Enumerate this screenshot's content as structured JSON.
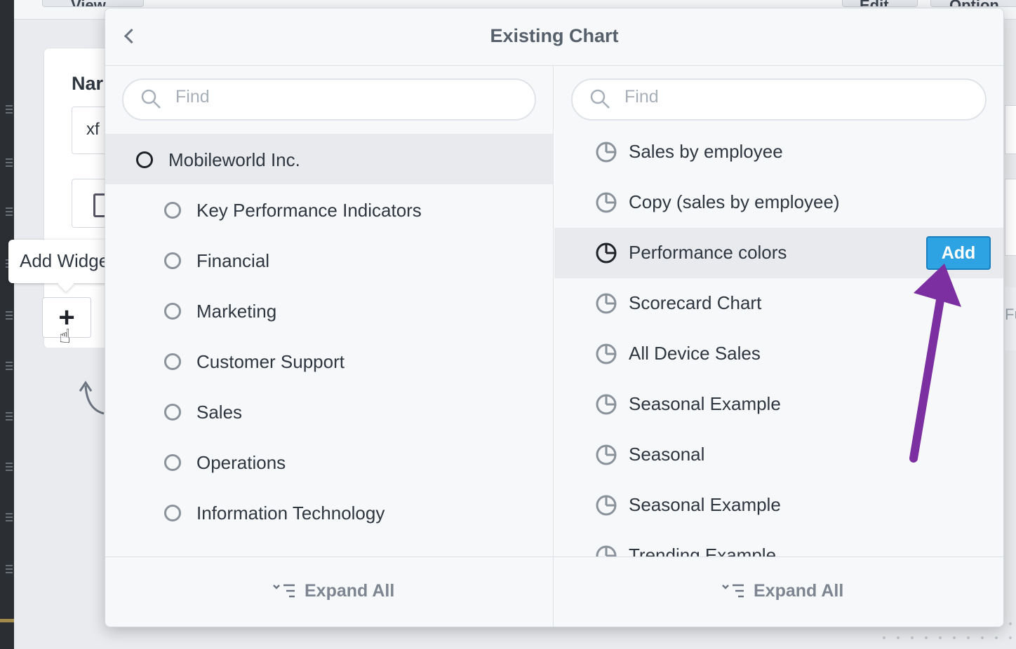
{
  "background": {
    "name_label": "Nar",
    "name_value": "xf",
    "right_fragment": "Fu",
    "top_tabs": [
      "View",
      "Edit",
      "Option"
    ]
  },
  "tooltip": {
    "text": "Add Widget"
  },
  "add_widget": {
    "glyph": "+"
  },
  "modal": {
    "title": "Existing Chart",
    "left_pane": {
      "search_placeholder": "Find",
      "root": "Mobileworld Inc.",
      "items": [
        "Key Performance Indicators",
        "Financial",
        "Marketing",
        "Customer Support",
        "Sales",
        "Operations",
        "Information Technology"
      ],
      "expand_label": "Expand All"
    },
    "right_pane": {
      "search_placeholder": "Find",
      "items": [
        "Sales by employee",
        "Copy (sales by employee)",
        "Performance colors",
        "Scorecard Chart",
        "All Device Sales",
        "Seasonal Example",
        "Seasonal",
        "Seasonal Example",
        "Trending Example"
      ],
      "selected_item": "Performance colors",
      "add_label": "Add",
      "expand_label": "Expand All"
    }
  },
  "colors": {
    "accent": "#2ea3e3",
    "annotation_arrow": "#7b2fa0"
  }
}
